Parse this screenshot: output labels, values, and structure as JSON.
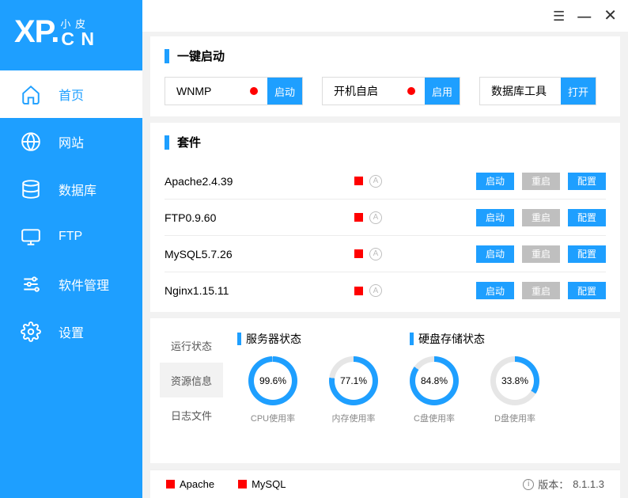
{
  "logo": {
    "main": "XP.",
    "top": "小 皮",
    "bottom": "C N"
  },
  "nav": [
    {
      "label": "首页",
      "icon": "home"
    },
    {
      "label": "网站",
      "icon": "globe"
    },
    {
      "label": "数据库",
      "icon": "database"
    },
    {
      "label": "FTP",
      "icon": "monitor"
    },
    {
      "label": "软件管理",
      "icon": "sliders"
    },
    {
      "label": "设置",
      "icon": "gear"
    }
  ],
  "sections": {
    "quick_start": "一键启动",
    "suite": "套件"
  },
  "quick": [
    {
      "label": "WNMP",
      "btn": "启动",
      "dot": true
    },
    {
      "label": "开机自启",
      "btn": "启用",
      "dot": true
    },
    {
      "label": "数据库工具",
      "btn": "打开",
      "dot": false
    }
  ],
  "suites": [
    {
      "name": "Apache2.4.39",
      "b1": "启动",
      "b2": "重启",
      "b3": "配置"
    },
    {
      "name": "FTP0.9.60",
      "b1": "启动",
      "b2": "重启",
      "b3": "配置"
    },
    {
      "name": "MySQL5.7.26",
      "b1": "启动",
      "b2": "重启",
      "b3": "配置"
    },
    {
      "name": "Nginx1.15.11",
      "b1": "启动",
      "b2": "重启",
      "b3": "配置"
    }
  ],
  "status_tabs": [
    "运行状态",
    "资源信息",
    "日志文件"
  ],
  "status_heads": [
    "服务器状态",
    "硬盘存储状态"
  ],
  "gauges": [
    {
      "value": "99.6%",
      "label": "CPU使用率",
      "pct": 99.6
    },
    {
      "value": "77.1%",
      "label": "内存使用率",
      "pct": 77.1
    },
    {
      "value": "84.8%",
      "label": "C盘使用率",
      "pct": 84.8
    },
    {
      "value": "33.8%",
      "label": "D盘使用率",
      "pct": 33.8
    }
  ],
  "footer": {
    "services": [
      "Apache",
      "MySQL"
    ],
    "version_label": "版本：",
    "version": "8.1.1.3"
  }
}
